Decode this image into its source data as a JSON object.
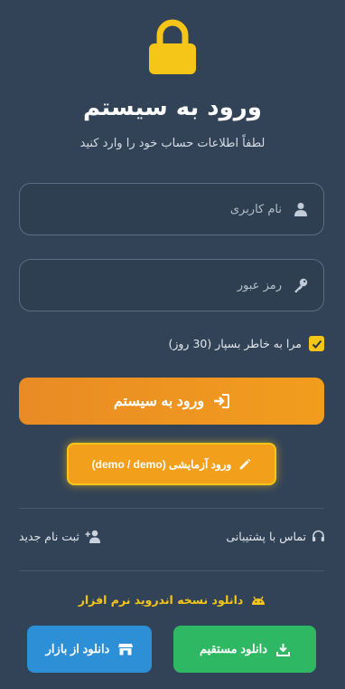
{
  "header": {
    "title": "ورود به سیستم",
    "subtitle": "لطفاً اطلاعات حساب خود را وارد کنید"
  },
  "form": {
    "username_placeholder": "نام کاربری",
    "password_placeholder": "رمز عبور",
    "remember_label": "مرا به خاطر بسپار (30 روز)",
    "remember_checked": true,
    "login_label": "ورود به سیستم",
    "demo_label": "ورود آزمایشی (demo / demo)"
  },
  "links": {
    "support_label": "تماس با پشتیبانی",
    "register_label": "ثبت نام جدید"
  },
  "android": {
    "label": "دانلود نسخه اندروید نرم افزار",
    "direct_label": "دانلود مستقیم",
    "bazaar_label": "دانلود از بازار"
  },
  "colors": {
    "background": "#324358",
    "accent_yellow": "#f5c518",
    "login_orange": "#f29d1d",
    "direct_green": "#2fb863",
    "bazaar_blue": "#2d8fd6"
  },
  "icons": {
    "lock": "lock-icon",
    "user": "user-icon",
    "key": "key-icon",
    "login": "sign-in-icon",
    "pencil": "pencil-icon",
    "headset": "headset-icon",
    "user_plus": "user-plus-icon",
    "android": "android-icon",
    "download": "download-icon",
    "store": "store-icon"
  }
}
